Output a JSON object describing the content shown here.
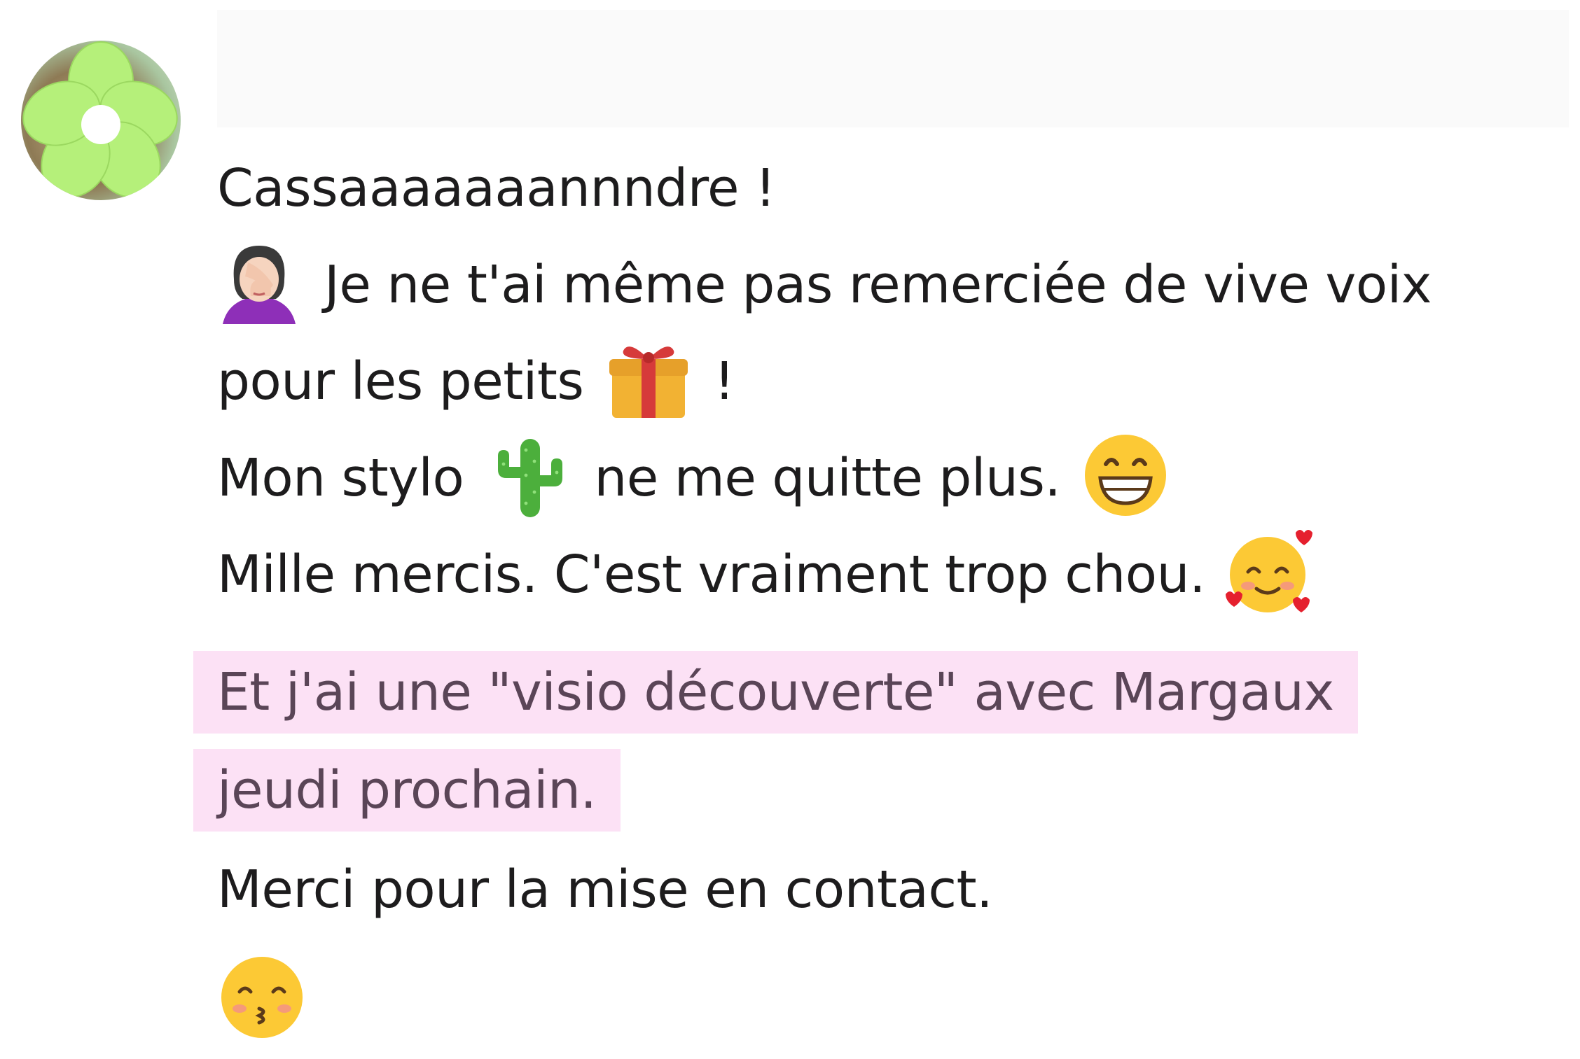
{
  "message": {
    "lines": {
      "l1": "Cassaaaaaaannndre !",
      "l2": "Je ne t'ai même pas remerciée de vive voix",
      "l3a": "pour les petits",
      "l3b": "!",
      "l4a": "Mon stylo",
      "l4b": "ne me quitte plus.",
      "l5": "Mille mercis. C'est vraiment trop chou.",
      "h1": "Et j'ai une \"visio découverte\" avec Margaux",
      "h2": "jeudi prochain.",
      "l6": "Merci pour la mise en contact."
    },
    "highlight_color": "#fce1f5",
    "emojis": {
      "facepalm": "woman-facepalming-icon",
      "gift": "gift-icon",
      "cactus": "cactus-icon",
      "grin": "grinning-face-icon",
      "hearts": "smiling-face-with-hearts-icon",
      "kiss": "kissing-face-icon"
    }
  }
}
